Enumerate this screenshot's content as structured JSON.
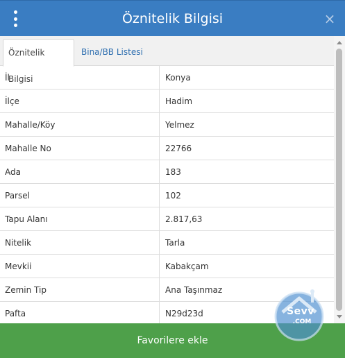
{
  "header": {
    "title": "Öznitelik Bilgisi",
    "close_symbol": "×"
  },
  "tabs": [
    {
      "label": "Öznitelik Bilgisi",
      "active": true
    },
    {
      "label": "Bina/BB Listesi",
      "active": false
    }
  ],
  "rows": [
    {
      "label": "İl",
      "value": "Konya"
    },
    {
      "label": "İlçe",
      "value": "Hadim"
    },
    {
      "label": "Mahalle/Köy",
      "value": "Yelmez"
    },
    {
      "label": "Mahalle No",
      "value": "22766"
    },
    {
      "label": "Ada",
      "value": "183"
    },
    {
      "label": "Parsel",
      "value": "102"
    },
    {
      "label": "Tapu Alanı",
      "value": "2.817,63"
    },
    {
      "label": "Nitelik",
      "value": "Tarla"
    },
    {
      "label": "Mevkii",
      "value": "Kabakçam"
    },
    {
      "label": "Zemin Tip",
      "value": "Ana Taşınmaz"
    },
    {
      "label": "Pafta",
      "value": "N29d23d"
    }
  ],
  "footer": {
    "button_label": "Favorilere ekle"
  },
  "watermark": {
    "main": "Sevv",
    "sub": ".COM"
  },
  "colors": {
    "header_bg": "#3a7dc2",
    "tab_link": "#2f6fb0",
    "footer_bg": "#4ea04a"
  },
  "icons": {
    "menu": "vertical-dots-icon",
    "close": "close-icon"
  }
}
